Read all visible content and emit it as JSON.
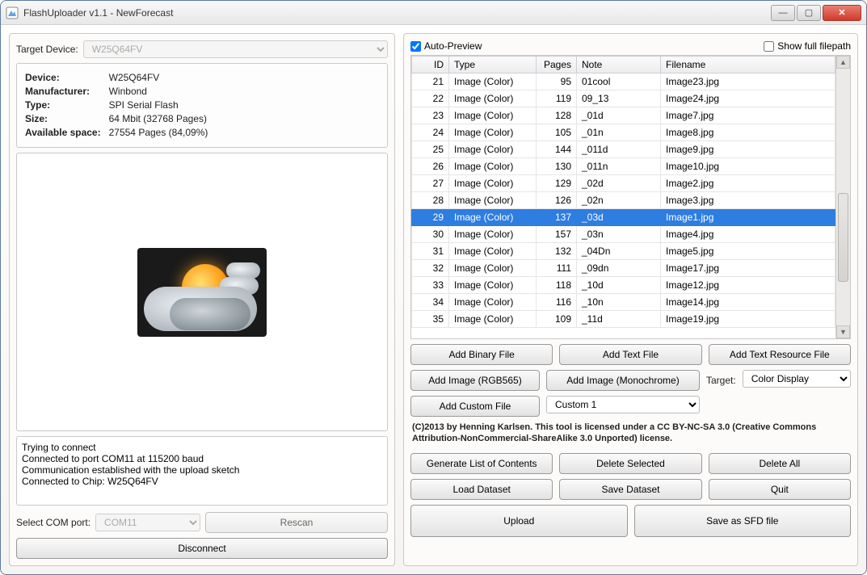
{
  "window": {
    "title": "FlashUploader v1.1 - NewForecast"
  },
  "left": {
    "target_device_label": "Target Device:",
    "target_device_value": "W25Q64FV",
    "device_info": {
      "Device": "W25Q64FV",
      "Manufacturer": "Winbond",
      "Type": "SPI Serial Flash",
      "Size": "64 Mbit (32768 Pages)",
      "Available_space_label": "Available space:",
      "Available_space": "27554 Pages (84,09%)"
    },
    "log": "Trying to connect\nConnected to port COM11 at 115200 baud\nCommunication established with the upload sketch\nConnected to Chip: W25Q64FV",
    "com_label": "Select COM port:",
    "com_value": "COM11",
    "rescan": "Rescan",
    "disconnect": "Disconnect"
  },
  "right": {
    "auto_preview": "Auto-Preview",
    "show_full_path": "Show full filepath",
    "headers": {
      "id": "ID",
      "type": "Type",
      "pages": "Pages",
      "note": "Note",
      "filename": "Filename"
    },
    "rows": [
      {
        "id": 21,
        "type": "Image (Color)",
        "pages": 95,
        "note": "01cool",
        "file": "Image23.jpg",
        "sel": false
      },
      {
        "id": 22,
        "type": "Image (Color)",
        "pages": 119,
        "note": "09_13",
        "file": "Image24.jpg",
        "sel": false
      },
      {
        "id": 23,
        "type": "Image (Color)",
        "pages": 128,
        "note": "_01d",
        "file": "Image7.jpg",
        "sel": false
      },
      {
        "id": 24,
        "type": "Image (Color)",
        "pages": 105,
        "note": "_01n",
        "file": "Image8.jpg",
        "sel": false
      },
      {
        "id": 25,
        "type": "Image (Color)",
        "pages": 144,
        "note": "_011d",
        "file": "Image9.jpg",
        "sel": false
      },
      {
        "id": 26,
        "type": "Image (Color)",
        "pages": 130,
        "note": "_011n",
        "file": "Image10.jpg",
        "sel": false
      },
      {
        "id": 27,
        "type": "Image (Color)",
        "pages": 129,
        "note": "_02d",
        "file": "Image2.jpg",
        "sel": false
      },
      {
        "id": 28,
        "type": "Image (Color)",
        "pages": 126,
        "note": "_02n",
        "file": "Image3.jpg",
        "sel": false
      },
      {
        "id": 29,
        "type": "Image (Color)",
        "pages": 137,
        "note": "_03d",
        "file": "Image1.jpg",
        "sel": true
      },
      {
        "id": 30,
        "type": "Image (Color)",
        "pages": 157,
        "note": "_03n",
        "file": "Image4.jpg",
        "sel": false
      },
      {
        "id": 31,
        "type": "Image (Color)",
        "pages": 132,
        "note": "_04Dn",
        "file": "Image5.jpg",
        "sel": false
      },
      {
        "id": 32,
        "type": "Image (Color)",
        "pages": 111,
        "note": "_09dn",
        "file": "Image17.jpg",
        "sel": false
      },
      {
        "id": 33,
        "type": "Image (Color)",
        "pages": 118,
        "note": "_10d",
        "file": "Image12.jpg",
        "sel": false
      },
      {
        "id": 34,
        "type": "Image (Color)",
        "pages": 116,
        "note": "_10n",
        "file": "Image14.jpg",
        "sel": false
      },
      {
        "id": 35,
        "type": "Image (Color)",
        "pages": 109,
        "note": "_11d",
        "file": "Image19.jpg",
        "sel": false
      }
    ],
    "buttons": {
      "add_binary": "Add Binary File",
      "add_text": "Add Text File",
      "add_text_res": "Add Text Resource File",
      "add_img_rgb": "Add Image (RGB565)",
      "add_img_mono": "Add Image (Monochrome)",
      "target_label": "Target:",
      "target_value": "Color Display",
      "add_custom": "Add Custom File",
      "custom_value": "Custom 1",
      "license": "(C)2013 by Henning Karlsen. This tool is licensed under a CC BY-NC-SA 3.0 (Creative Commons Attribution-NonCommercial-ShareAlike 3.0 Unported) license.",
      "gen_list": "Generate List of Contents",
      "del_sel": "Delete Selected",
      "del_all": "Delete All",
      "load_ds": "Load Dataset",
      "save_ds": "Save Dataset",
      "quit": "Quit",
      "upload": "Upload",
      "save_sfd": "Save as SFD file"
    }
  }
}
